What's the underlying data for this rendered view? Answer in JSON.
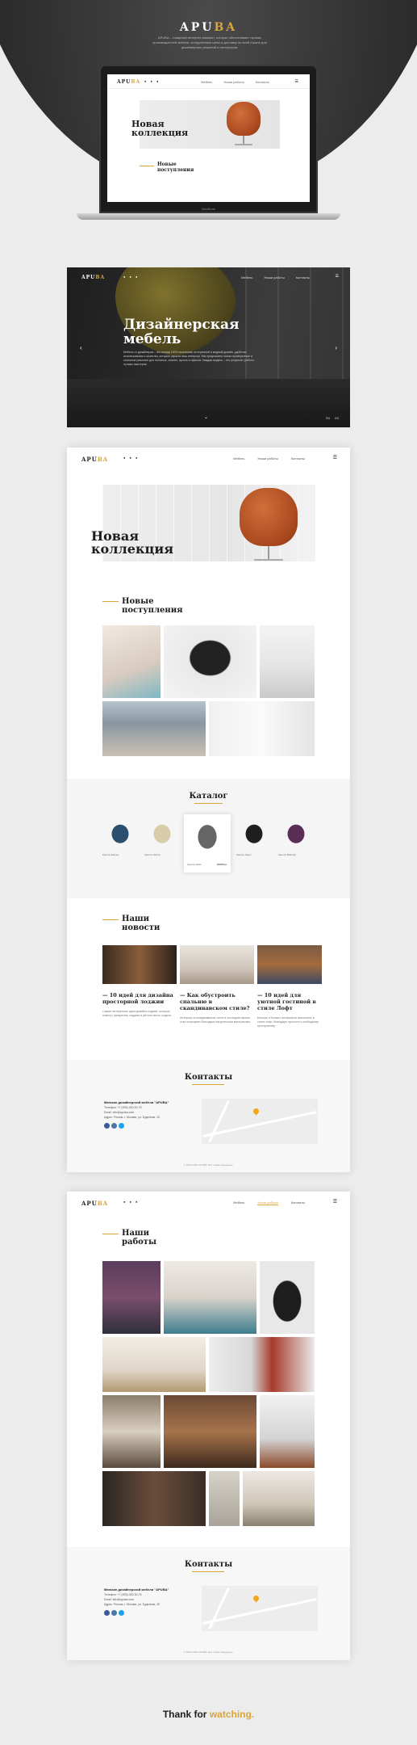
{
  "hero": {
    "logo_main": "APU",
    "logo_accent": "BA",
    "description": "APUBA – товарный интернет-магазин, которое обеспечивает лучших производителей мебели: конкурентные цены и доставку по всей стране для дизайнерских решений и интерьеров.",
    "laptop_label": "MacBook"
  },
  "nav": {
    "logo_main": "APU",
    "logo_accent": "BA",
    "dots": "● ● ●",
    "links": [
      "Мебель",
      "Наши работы",
      "Контакты"
    ],
    "menu_icon": "☰"
  },
  "collection": {
    "title_line1": "Новая",
    "title_line2": "коллекция",
    "new_line1": "Новые",
    "new_line2": "поступления"
  },
  "slider": {
    "title_line1": "Дизайнерская",
    "title_line2": "мебель",
    "text": "Мебель от дизайнеров – это всегда 100% эксклюзив, интересный и модный дизайн, удобство использования и качество, которые украсят ваш интерьер. Мы предлагаем только проверенные и стильные решения для гостиных, спален, кухонь и офисов. Каждая модель – это результат работы лучших мастеров.",
    "prev": "‹",
    "next": "›",
    "down": "⌄",
    "lang": [
      "RU",
      "EN"
    ]
  },
  "catalog": {
    "title": "Каталог",
    "items": [
      {
        "label": "Кресло Eames",
        "price": ""
      },
      {
        "label": "Кресло Womb",
        "price": ""
      },
      {
        "label": "Кресло EGG",
        "price": "180000 р."
      },
      {
        "label": "Кресло Swan",
        "price": ""
      },
      {
        "label": "Кресло Butterfly",
        "price": ""
      }
    ]
  },
  "news": {
    "title_line1": "Наши",
    "title_line2": "новости",
    "items": [
      {
        "title": "— 10 идей для дизайна просторной лоджии",
        "text": "Самые интересные идеи дизайна лоджий, которые помогут превратить лоджию в уютное место отдыха."
      },
      {
        "title": "— Как обустроить спальню в скандинавском стиле?",
        "text": "Интерьер в скандинавском стиле в последнее время стал популярен благодаря натуральным материалам."
      },
      {
        "title": "— 10 идей для уютной гостиной в стиле Лофт",
        "text": "Больше и больше интерьеров выполнено в стиле лофт, благодаря простоте и свободному пространству."
      }
    ]
  },
  "works": {
    "title_line1": "Наши",
    "title_line2": "работы"
  },
  "contacts": {
    "title": "Контакты",
    "company": "Магазин дизайнерской мебели \"APUBA\"",
    "phone": "Телефон: +7 (925) 000-00-75",
    "email": "Email: info@apuba.com",
    "address": "Адрес: Россия, г. Москва, ул. Буденная, 20",
    "copyright": "© 2020–2021 APUBA. Все права защищены."
  },
  "footer": {
    "thanks_text": "Thank for",
    "thanks_accent": "watching."
  },
  "colors": {
    "accent": "#d9a53a",
    "background": "#ececec"
  }
}
